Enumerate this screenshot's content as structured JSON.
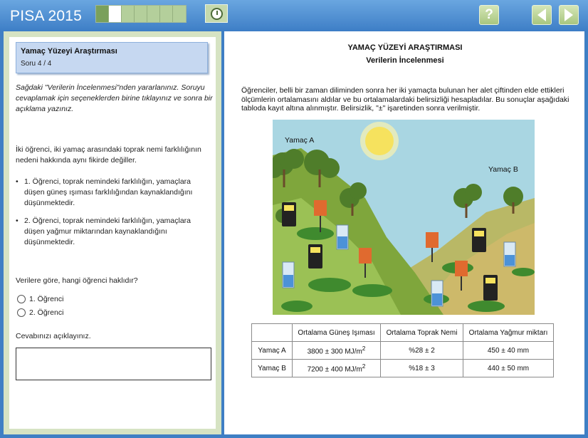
{
  "header": {
    "brand": "PISA 2015",
    "progress": {
      "total_segments": 7,
      "completed": 1,
      "current_index": 1
    },
    "icons": {
      "clock": "clock-icon",
      "help": "help-icon",
      "back": "back-arrow-icon",
      "forward": "forward-arrow-icon"
    },
    "help_label": "?"
  },
  "left": {
    "unit_title": "Yamaç Yüzeyi Araştırması",
    "question_counter": "Soru 4 / 4",
    "instruction": "Sağdaki \"Verilerin İncelenmesi\"nden yararlanınız. Soruyu cevaplamak için seçeneklerden birine tıklayınız ve sonra bir açıklama yazınız.",
    "scenario": "İki öğrenci, iki yamaç arasındaki toprak nemi farklılığının nedeni hakkında aynı fikirde değiller.",
    "bullets": [
      "1. Öğrenci, toprak nemindeki farklılığın, yamaçlara düşen güneş ışıması farklılığından kaynaklandığını düşünmektedir.",
      "2. Öğrenci, toprak nemindeki farklılığın, yamaçlara düşen yağmur miktarından kaynaklandığını düşünmektedir."
    ],
    "question": "Verilere göre, hangi öğrenci haklıdır?",
    "options": [
      "1. Öğrenci",
      "2. Öğrenci"
    ],
    "explain_prompt": "Cevabınızı açıklayınız.",
    "answer_value": ""
  },
  "right": {
    "title": "YAMAÇ YÜZEYİ ARAŞTIRMASI",
    "subtitle": "Verilerin İncelenmesi",
    "intro": "Öğrenciler, belli bir zaman diliminden sonra her iki yamaçta bulunan her alet çiftinden elde ettikleri ölçümlerin ortalamasını aldılar ve bu ortalamalardaki belirsizliği hesapladılar. Bu sonuçlar aşağıdaki tabloda kayıt altına alınmıştır. Belirsizlik, \"±\" işaretinden sonra verilmiştir.",
    "scene_labels": {
      "slope_a": "Yamaç A",
      "slope_b": "Yamaç B"
    },
    "colors": {
      "sky": "#a9d6e2",
      "slope_a": "#8fb648",
      "slope_b": "#c8b661",
      "sun": "#f6e25e"
    },
    "table": {
      "headers": [
        "",
        "Ortalama Güneş Işıması",
        "Ortalama Toprak Nemi",
        "Ortalama Yağmur miktarı"
      ],
      "rows": [
        {
          "label": "Yamaç A",
          "radiation": "3800 ± 300 MJ/m",
          "radiation_exp": "2",
          "moisture": "%28 ± 2",
          "rain": "450 ± 40 mm"
        },
        {
          "label": "Yamaç B",
          "radiation": "7200 ± 400 MJ/m",
          "radiation_exp": "2",
          "moisture": "%18 ± 3",
          "rain": "440 ± 50 mm"
        }
      ]
    }
  }
}
